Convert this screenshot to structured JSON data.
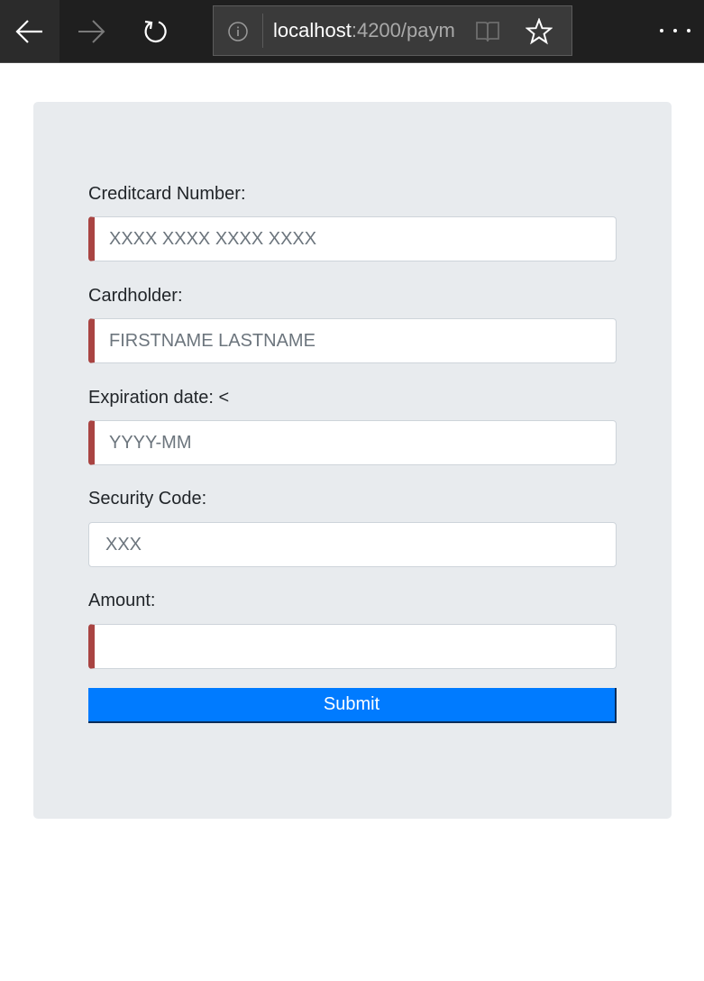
{
  "browser": {
    "url_host": "localhost",
    "url_rest": ":4200/paym",
    "icons": {
      "back": "arrow-left-icon",
      "forward": "arrow-right-icon",
      "refresh": "refresh-icon",
      "info": "info-icon",
      "reader": "reading-view-icon",
      "favorite": "star-icon",
      "more": "more-dots-icon"
    }
  },
  "form": {
    "fields": [
      {
        "label": "Creditcard Number:",
        "placeholder": "XXXX XXXX XXXX XXXX",
        "value": "",
        "invalid": true
      },
      {
        "label": "Cardholder:",
        "placeholder": "FIRSTNAME LASTNAME",
        "value": "",
        "invalid": true
      },
      {
        "label": "Expiration date: <",
        "placeholder": "YYYY-MM",
        "value": "",
        "invalid": true
      },
      {
        "label": "Security Code:",
        "placeholder": "XXX",
        "value": "",
        "invalid": false
      },
      {
        "label": "Amount:",
        "placeholder": "",
        "value": "",
        "invalid": true
      }
    ],
    "submit_label": "Submit"
  },
  "colors": {
    "toolbar_bg": "#1f1f1f",
    "card_bg": "#e8ebee",
    "invalid_border": "#a94442",
    "primary": "#007bff"
  }
}
